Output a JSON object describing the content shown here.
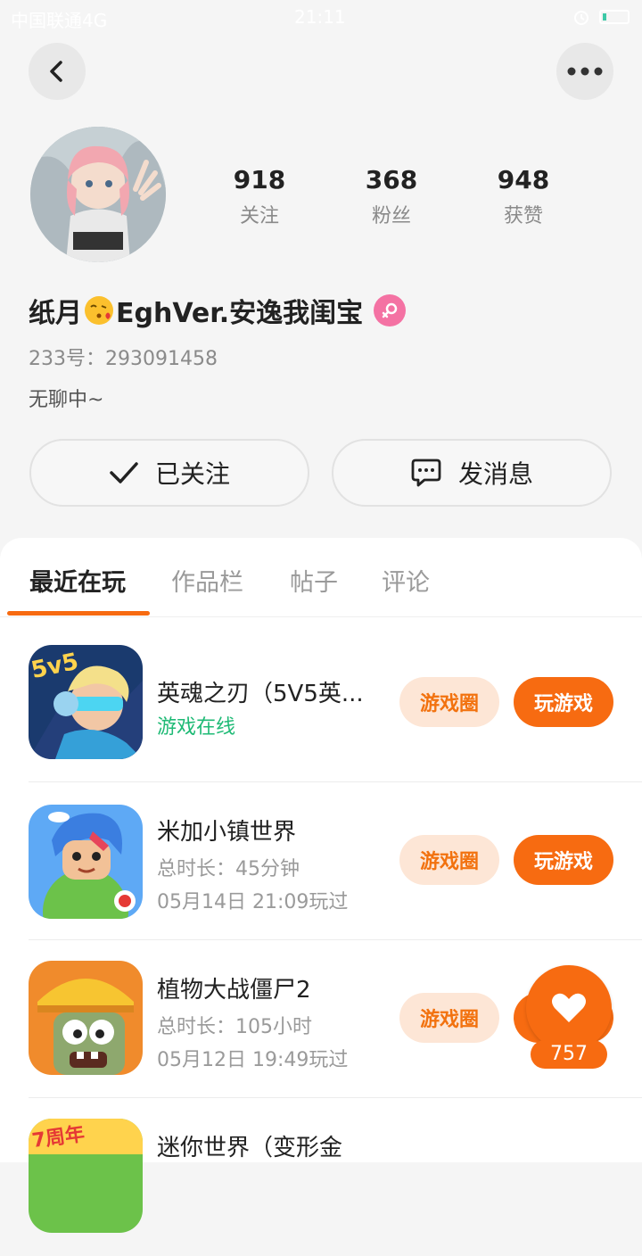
{
  "status_bar": {
    "carrier": "中国联通4G",
    "time": "21:11"
  },
  "profile": {
    "stats": [
      {
        "value": "918",
        "label": "关注"
      },
      {
        "value": "368",
        "label": "粉丝"
      },
      {
        "value": "948",
        "label": "获赞"
      }
    ],
    "name_prefix": "纸月",
    "name_suffix": "EghVer.安逸我闺宝",
    "id_label": "233号：293091458",
    "bio": "无聊中~"
  },
  "actions": {
    "follow_label": "已关注",
    "message_label": "发消息"
  },
  "tabs": [
    {
      "label": "最近在玩"
    },
    {
      "label": "作品栏"
    },
    {
      "label": "帖子"
    },
    {
      "label": "评论"
    }
  ],
  "games": [
    {
      "title": "英魂之刃（5V5英...",
      "line1": "游戏在线",
      "line2": "",
      "circle_label": "游戏圈",
      "play_label": "玩游戏"
    },
    {
      "title": "米加小镇世界",
      "line1": "总时长：45分钟",
      "line2": "05月14日 21:09玩过",
      "circle_label": "游戏圈",
      "play_label": "玩游戏"
    },
    {
      "title": "植物大战僵尸2",
      "line1": "总时长：105小时",
      "line2": "05月12日 19:49玩过",
      "circle_label": "游戏圈",
      "play_label": "玩游戏"
    },
    {
      "title": "迷你世界（变形金",
      "line1": "",
      "line2": ""
    }
  ],
  "floating_like": {
    "count": "757"
  },
  "colors": {
    "accent": "#f76b11",
    "online": "#1fba76",
    "gender_badge": "#f472a3"
  }
}
